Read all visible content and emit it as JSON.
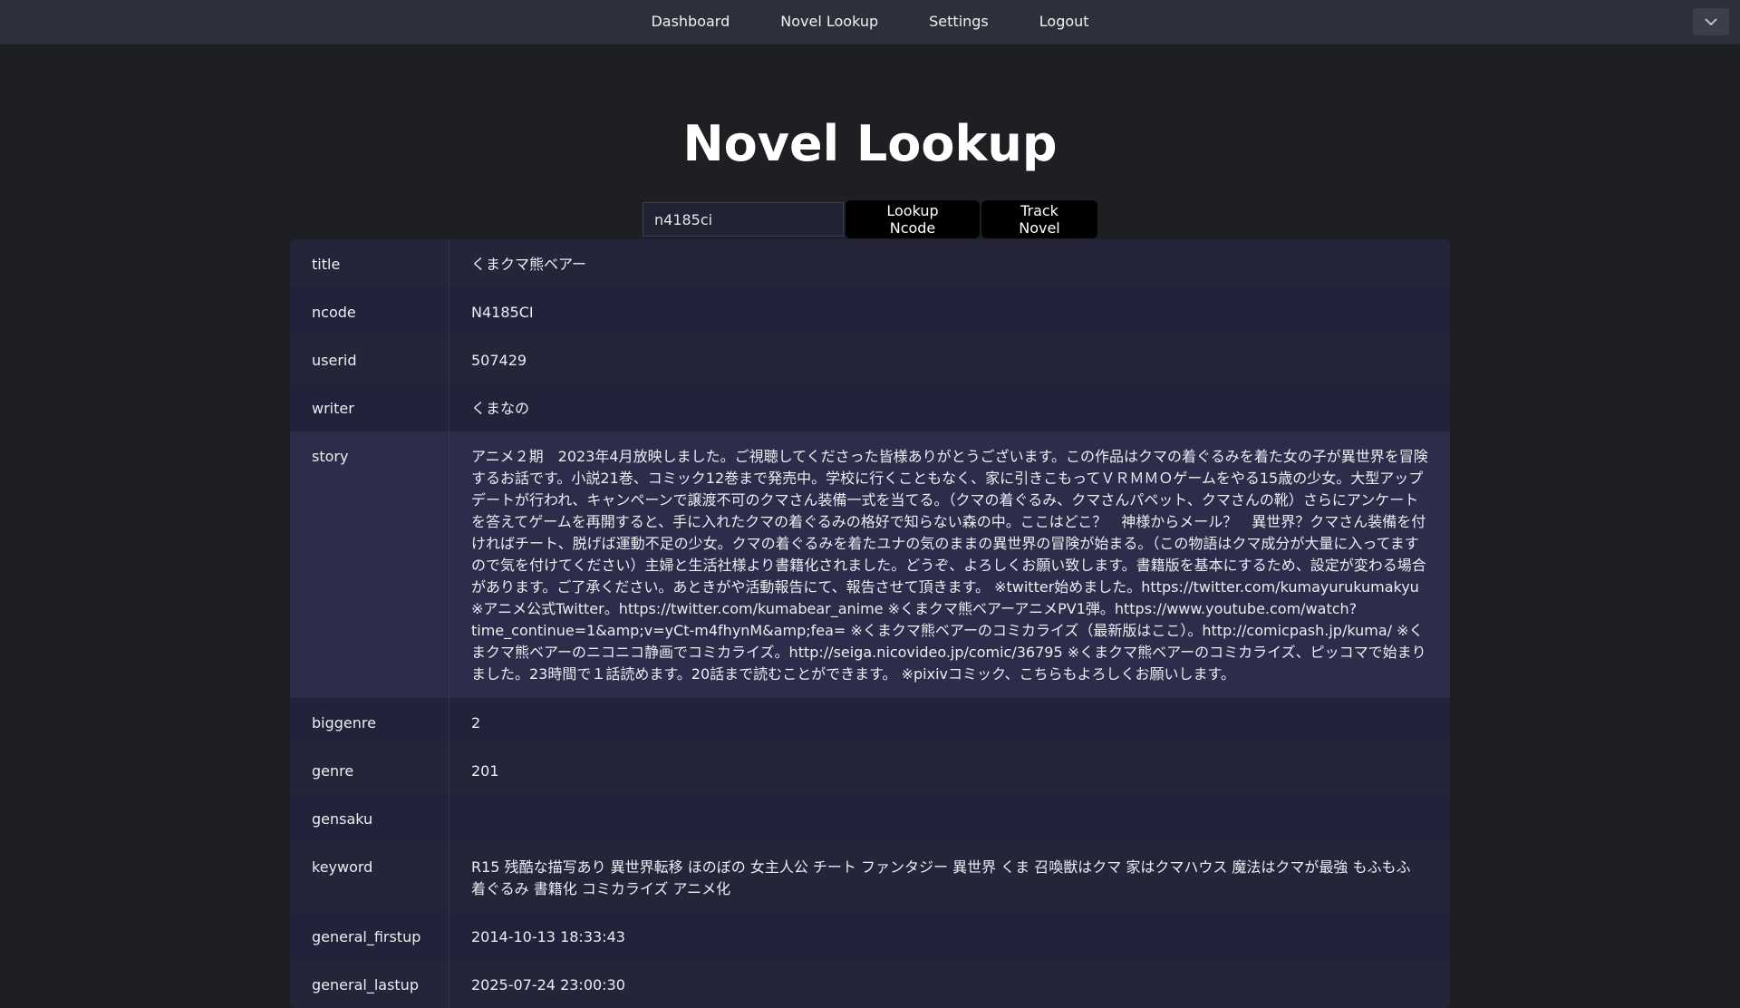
{
  "nav": {
    "items": [
      "Dashboard",
      "Novel Lookup",
      "Settings",
      "Logout"
    ]
  },
  "menu_toggle_icon": "chevron-down-icon",
  "page": {
    "title": "Novel Lookup"
  },
  "search": {
    "value": "n4185ci",
    "lookup_label": "Lookup Ncode",
    "track_label": "Track Novel"
  },
  "details": [
    {
      "key": "title",
      "value": "くまクマ熊ベアー"
    },
    {
      "key": "ncode",
      "value": "N4185CI"
    },
    {
      "key": "userid",
      "value": "507429"
    },
    {
      "key": "writer",
      "value": "くまなの"
    },
    {
      "key": "story",
      "value": "アニメ２期　2023年4月放映しました。ご視聴してくださった皆様ありがとうございます。この作品はクマの着ぐるみを着た女の子が異世界を冒険するお話です。小説21巻、コミック12巻まで発売中。学校に行くこともなく、家に引きこもってＶＲＭＭＯゲームをやる15歳の少女。大型アップデートが行われ、キャンペーンで譲渡不可のクマさん装備一式を当てる。（クマの着ぐるみ、クマさんパペット、クマさんの靴）さらにアンケートを答えてゲームを再開すると、手に入れたクマの着ぐるみの格好で知らない森の中。ここはどこ？　神様からメール？　異世界？クマさん装備を付ければチート、脱げば運動不足の少女。クマの着ぐるみを着たユナの気のままの異世界の冒険が始まる。（この物語はクマ成分が大量に入ってますので気を付けてください）主婦と生活社様より書籍化されました。どうぞ、よろしくお願い致します。書籍版を基本にするため、設定が変わる場合があります。ご了承ください。あときがや活動報告にて、報告させて頂きます。 ※twitter始めました。https://twitter.com/kumayurukumakyu ※アニメ公式Twitter。https://twitter.com/kumabear_anime ※くまクマ熊ベアーアニメPV1弾。https://www.youtube.com/watch?time_continue=1&amp;v=yCt-m4fhynM&amp;fea= ※くまクマ熊ベアーのコミカライズ（最新版はここ）。http://comicpash.jp/kuma/ ※くまクマ熊ベアーのニコニコ静画でコミカライズ。http://seiga.nicovideo.jp/comic/36795 ※くまクマ熊ベアーのコミカライズ、ピッコマで始まりました。23時間で１話読めます。20話まで読むことができます。 ※pixivコミック、こちらもよろしくお願いします。"
    },
    {
      "key": "biggenre",
      "value": "2"
    },
    {
      "key": "genre",
      "value": "201"
    },
    {
      "key": "gensaku",
      "value": ""
    },
    {
      "key": "keyword",
      "value": "R15 残酷な描写あり 異世界転移 ほのぼの 女主人公 チート ファンタジー 異世界 くま 召喚獣はクマ 家はクマハウス 魔法はクマが最強 もふもふ 着ぐるみ 書籍化 コミカライズ アニメ化"
    },
    {
      "key": "general_firstup",
      "value": "2014-10-13 18:33:43"
    },
    {
      "key": "general_lastup",
      "value": "2025-07-24 23:00:30"
    }
  ]
}
